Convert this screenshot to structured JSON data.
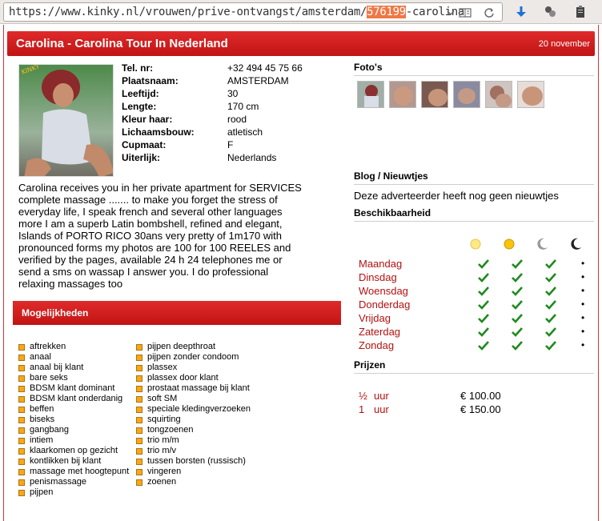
{
  "browser": {
    "url_prefix": "https://www.kinky.nl/vrouwen/prive-ontvangst/amsterdam/",
    "url_highlight": "576199",
    "url_suffix": "-carolina"
  },
  "header": {
    "title": "Carolina - Carolina Tour In Nederland",
    "date": "20 november"
  },
  "profile": {
    "fields": [
      {
        "label": "Tel. nr:",
        "value": "+32 494 45 75 66"
      },
      {
        "label": "Plaatsnaam:",
        "value": "AMSTERDAM"
      },
      {
        "label": "Leeftijd:",
        "value": "30"
      },
      {
        "label": "Lengte:",
        "value": "170 cm"
      },
      {
        "label": "Kleur haar:",
        "value": "rood"
      },
      {
        "label": "Lichaamsbouw:",
        "value": "atletisch"
      },
      {
        "label": "Cupmaat:",
        "value": "F"
      },
      {
        "label": "Uiterlijk:",
        "value": "Nederlands"
      }
    ],
    "description_lines": [
      "Carolina receives you in her private apartment for SERVICES",
      "complete massage ....... to make you forget the stress of",
      "everyday life, I speak french and several other languages",
      "more I am a superb Latin bombshell, refined and elegant,",
      "Islands of PORTO RICO 30ans very pretty of 1m170 with",
      "pronounced forms my photos are 100 for 100 REELES and",
      "verified by the pages, available 24 h 24 telephones me or",
      "send a sms on wassap I answer you. I do professional",
      "relaxing massages too"
    ]
  },
  "mogelijkheden": {
    "title": "Mogelijkheden",
    "col1": [
      "aftrekken",
      "anaal",
      "anaal bij klant",
      "bare seks",
      "BDSM klant dominant",
      "BDSM klant onderdanig",
      "beffen",
      "biseks",
      "gangbang",
      "intiem",
      "klaarkomen op gezicht",
      "kontlikken bij klant",
      "massage met hoogtepunt",
      "penismassage",
      "pijpen"
    ],
    "col2": [
      "pijpen deepthroat",
      "pijpen zonder condoom",
      "plassex",
      "plassex door klant",
      "prostaat massage bij klant",
      "soft SM",
      "speciale kledingverzoeken",
      "squirting",
      "tongzoenen",
      "trio m/m",
      "trio m/v",
      "tussen borsten (russisch)",
      "vingeren",
      "zoenen"
    ]
  },
  "sidebar": {
    "photos_title": "Foto's",
    "blog_title": "Blog / Nieuwtjes",
    "blog_text": "Deze adverteerder heeft nog geen nieuwtjes",
    "availability_title": "Beschikbaarheid",
    "days": [
      "Maandag",
      "Dinsdag",
      "Woensdag",
      "Donderdag",
      "Vrijdag",
      "Zaterdag",
      "Zondag"
    ],
    "prices_title": "Prijzen",
    "prices": [
      {
        "qty": "½",
        "unit": "uur",
        "amount": "€ 100.00"
      },
      {
        "qty": "1",
        "unit": "uur",
        "amount": "€ 150.00"
      }
    ]
  },
  "colors": {
    "accent": "#c8161a",
    "check": "#1f8a1f",
    "day_text": "#b31111"
  }
}
